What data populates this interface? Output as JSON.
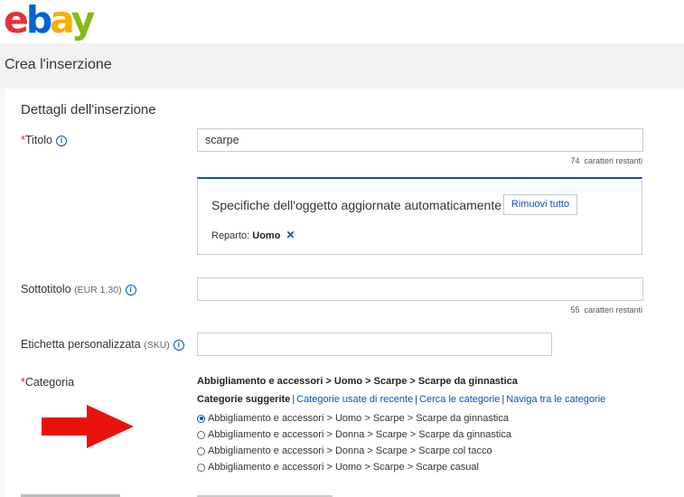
{
  "logo": {
    "e": "e",
    "b": "b",
    "a": "a",
    "y": "y"
  },
  "page_title": "Crea l'inserzione",
  "section_title": "Dettagli dell'inserzione",
  "title_field": {
    "label": "Titolo",
    "value": "scarpe",
    "counter_num": "74",
    "counter_text": "caratteri restanti"
  },
  "specifics": {
    "heading": "Specifiche dell'oggetto aggiornate automaticamente",
    "remove_all": "Rimuovi tutto",
    "dept_label": "Reparto:",
    "dept_value": "Uomo",
    "remove_icon": "✕"
  },
  "subtitle_field": {
    "label": "Sottotitolo",
    "price": "(EUR 1,30)",
    "value": "",
    "counter_num": "55",
    "counter_text": "caratteri restanti"
  },
  "sku_field": {
    "label": "Etichetta personalizzata",
    "suffix": "(SKU)",
    "value": ""
  },
  "category": {
    "label": "Categoria",
    "selected_path": "Abbigliamento e accessori > Uomo > Scarpe > Scarpe da ginnastica",
    "tabs": [
      "Categorie suggerite",
      "Categorie usate di recente",
      "Cerca le categorie",
      "Naviga tra le categorie"
    ],
    "options": [
      "Abbigliamento e accessori > Uomo > Scarpe > Scarpe da ginnastica",
      "Abbigliamento e accessori > Donna > Scarpe > Scarpe da ginnastica",
      "Abbigliamento e accessori > Donna > Scarpe > Scarpe col tacco",
      "Abbigliamento e accessori > Uomo > Scarpe > Scarpe casual"
    ]
  },
  "colors": {
    "accent": "#0654ba",
    "required": "#e0242b",
    "arrow": "#e8120c"
  }
}
